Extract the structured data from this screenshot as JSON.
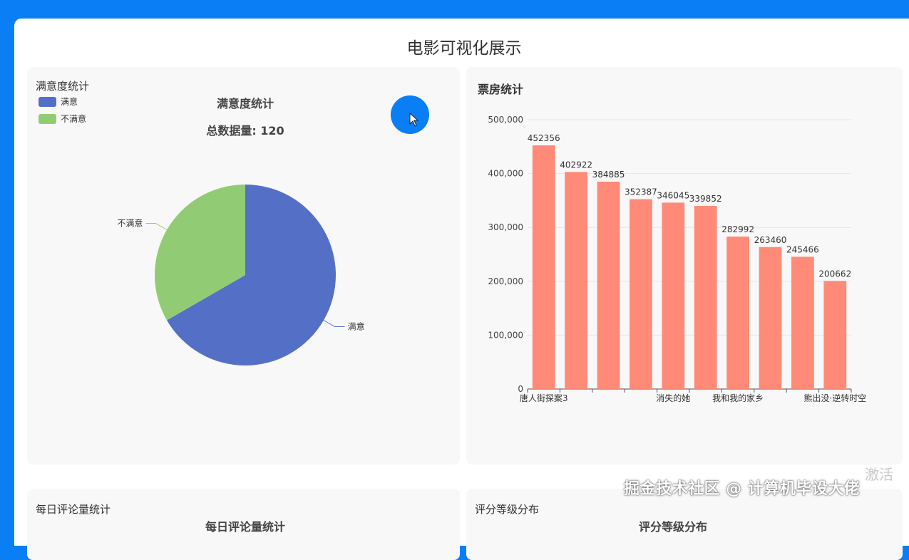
{
  "page": {
    "title": "电影可视化展示"
  },
  "satisfaction_panel": {
    "label": "满意度统计",
    "chart_title": "满意度统计",
    "subtitle": "总数据量: 120",
    "legend": [
      {
        "name": "满意",
        "color": "#5470c6"
      },
      {
        "name": "不满意",
        "color": "#91cc75"
      }
    ]
  },
  "boxoffice_panel": {
    "label": "票房统计"
  },
  "comments_panel": {
    "label": "每日评论量统计",
    "chart_title": "每日评论量统计"
  },
  "rating_panel": {
    "label": "评分等级分布",
    "chart_title": "评分等级分布"
  },
  "overlay": {
    "watermark": "掘金技术社区 @ 计算机毕设大佬",
    "activate": "激活"
  },
  "chart_data": [
    {
      "type": "pie",
      "title": "满意度统计",
      "subtitle": "总数据量: 120",
      "slices": [
        {
          "name": "满意",
          "value": 80,
          "color": "#5470c6"
        },
        {
          "name": "不满意",
          "value": 40,
          "color": "#91cc75"
        }
      ],
      "legend_position": "top-left"
    },
    {
      "type": "bar",
      "title": "票房统计",
      "categories": [
        "唐人街探案3",
        "",
        "",
        "",
        "消失的她",
        "",
        "我和我的家乡",
        "",
        "",
        "熊出没·逆转时空"
      ],
      "values": [
        452356,
        402922,
        384885,
        352387,
        346045,
        339852,
        282992,
        263460,
        245466,
        200662
      ],
      "ylim": [
        0,
        500000
      ],
      "yticks": [
        0,
        100000,
        200000,
        300000,
        400000,
        500000
      ],
      "ytick_labels": [
        "0",
        "100,000",
        "200,000",
        "300,000",
        "400,000",
        "500,000"
      ],
      "color": "#ff8a78",
      "grid": true
    }
  ]
}
